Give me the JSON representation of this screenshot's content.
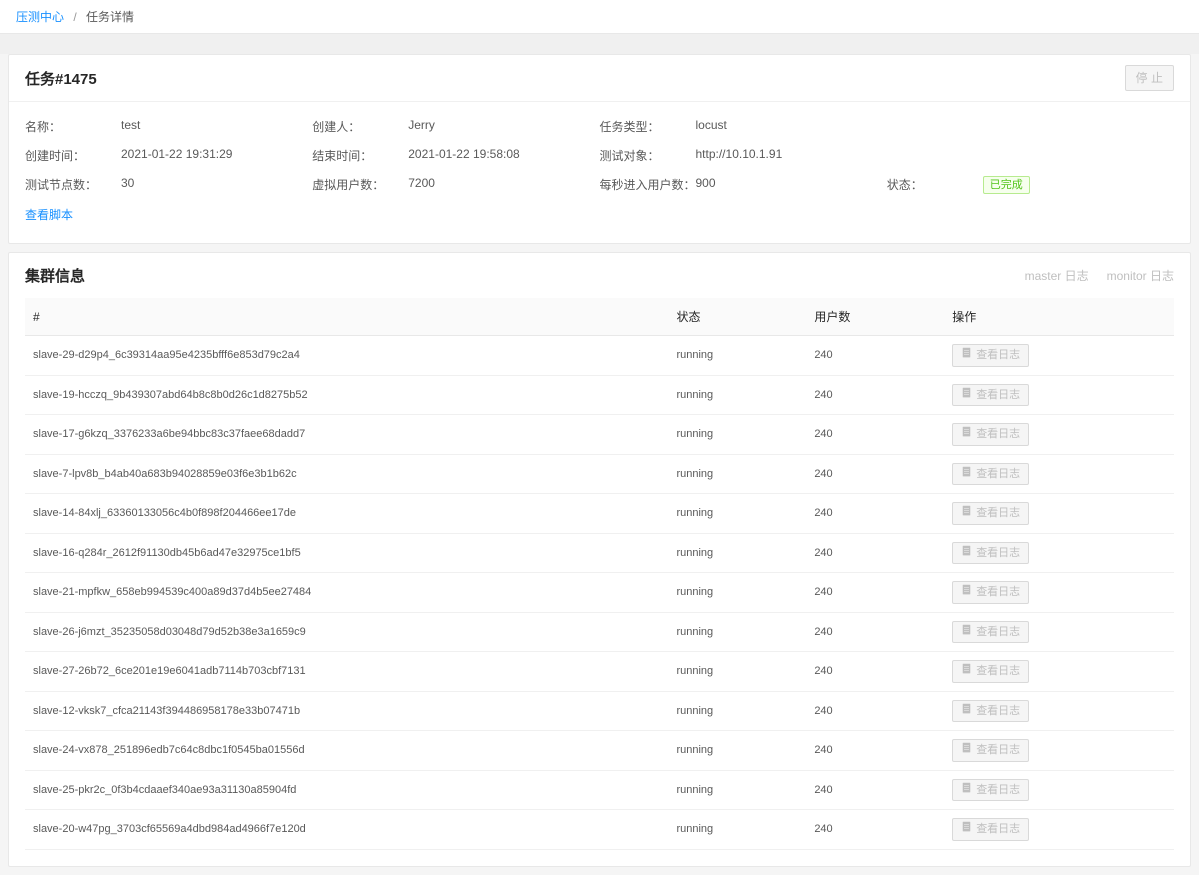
{
  "breadcrumb": {
    "root": "压测中心",
    "current": "任务详情"
  },
  "task": {
    "title": "任务#1475",
    "stop_label": "停 止"
  },
  "info": {
    "labels": {
      "name": "名称：",
      "creator": "创建人：",
      "type": "任务类型：",
      "createTime": "创建时间：",
      "endTime": "结束时间：",
      "target": "测试对象：",
      "nodes": "测试节点数：",
      "vusers": "虚拟用户数：",
      "spawn": "每秒进入用户数：",
      "status": "状态：",
      "viewScript": "查看脚本"
    },
    "values": {
      "name": "test",
      "creator": "Jerry",
      "type": "locust",
      "createTime": "2021-01-22 19:31:29",
      "endTime": "2021-01-22 19:58:08",
      "target": "http://10.10.1.91",
      "nodes": "30",
      "vusers": "7200",
      "spawn": "900",
      "status_tag": "已完成"
    }
  },
  "cluster": {
    "title": "集群信息",
    "master_log": "master 日志",
    "monitor_log": "monitor 日志",
    "columns": {
      "id": "#",
      "state": "状态",
      "users": "用户数",
      "op": "操作"
    },
    "view_log_label": "查看日志",
    "rows": [
      {
        "id": "slave-29-d29p4_6c39314aa95e4235bfff6e853d79c2a4",
        "state": "running",
        "users": "240"
      },
      {
        "id": "slave-19-hcczq_9b439307abd64b8c8b0d26c1d8275b52",
        "state": "running",
        "users": "240"
      },
      {
        "id": "slave-17-g6kzq_3376233a6be94bbc83c37faee68dadd7",
        "state": "running",
        "users": "240"
      },
      {
        "id": "slave-7-lpv8b_b4ab40a683b94028859e03f6e3b1b62c",
        "state": "running",
        "users": "240"
      },
      {
        "id": "slave-14-84xlj_63360133056c4b0f898f204466ee17de",
        "state": "running",
        "users": "240"
      },
      {
        "id": "slave-16-q284r_2612f91130db45b6ad47e32975ce1bf5",
        "state": "running",
        "users": "240"
      },
      {
        "id": "slave-21-mpfkw_658eb994539c400a89d37d4b5ee27484",
        "state": "running",
        "users": "240"
      },
      {
        "id": "slave-26-j6mzt_35235058d03048d79d52b38e3a1659c9",
        "state": "running",
        "users": "240"
      },
      {
        "id": "slave-27-26b72_6ce201e19e6041adb7114b703cbf7131",
        "state": "running",
        "users": "240"
      },
      {
        "id": "slave-12-vksk7_cfca21143f394486958178e33b07471b",
        "state": "running",
        "users": "240"
      },
      {
        "id": "slave-24-vx878_251896edb7c64c8dbc1f0545ba01556d",
        "state": "running",
        "users": "240"
      },
      {
        "id": "slave-25-pkr2c_0f3b4cdaaef340ae93a31130a85904fd",
        "state": "running",
        "users": "240"
      },
      {
        "id": "slave-20-w47pg_3703cf65569a4dbd984ad4966f7e120d",
        "state": "running",
        "users": "240"
      }
    ]
  }
}
